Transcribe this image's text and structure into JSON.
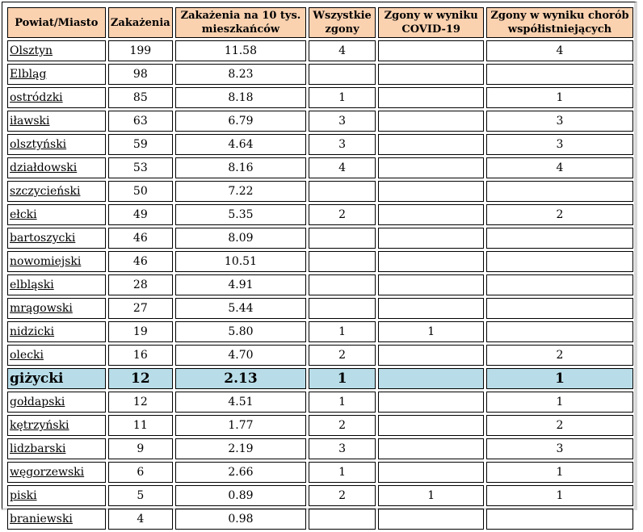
{
  "table": {
    "headers": [
      "Powiat/Miasto",
      "Zakażenia",
      "Zakażenia na 10 tys. mieszkańców",
      "Wszystkie zgony",
      "Zgony w wyniku COVID-19",
      "Zgony w wyniku chorób współistniejących"
    ],
    "rows": [
      [
        "Olsztyn",
        "199",
        "11.58",
        "4",
        "",
        "4"
      ],
      [
        "Elbląg",
        "98",
        "8.23",
        "",
        "",
        ""
      ],
      [
        "ostródzki",
        "85",
        "8.18",
        "1",
        "",
        "1"
      ],
      [
        "iławski",
        "63",
        "6.79",
        "3",
        "",
        "3"
      ],
      [
        "olsztyński",
        "59",
        "4.64",
        "3",
        "",
        "3"
      ],
      [
        "działdowski",
        "53",
        "8.16",
        "4",
        "",
        "4"
      ],
      [
        "szczycieński",
        "50",
        "7.22",
        "",
        "",
        ""
      ],
      [
        "ełcki",
        "49",
        "5.35",
        "2",
        "",
        "2"
      ],
      [
        "bartoszycki",
        "46",
        "8.09",
        "",
        "",
        ""
      ],
      [
        "nowomiejski",
        "46",
        "10.51",
        "",
        "",
        ""
      ],
      [
        "elbląski",
        "28",
        "4.91",
        "",
        "",
        ""
      ],
      [
        "mrągowski",
        "27",
        "5.44",
        "",
        "",
        ""
      ],
      [
        "nidzicki",
        "19",
        "5.80",
        "1",
        "1",
        ""
      ],
      [
        "olecki",
        "16",
        "4.70",
        "2",
        "",
        "2"
      ],
      [
        "giżycki",
        "12",
        "2.13",
        "1",
        "",
        "1"
      ],
      [
        "gołdapski",
        "12",
        "4.51",
        "1",
        "",
        "1"
      ],
      [
        "kętrzyński",
        "11",
        "1.77",
        "2",
        "",
        "2"
      ],
      [
        "lidzbarski",
        "9",
        "2.19",
        "3",
        "",
        "3"
      ],
      [
        "węgorzewski",
        "6",
        "2.66",
        "1",
        "",
        "1"
      ],
      [
        "piski",
        "5",
        "0.89",
        "2",
        "1",
        "1"
      ],
      [
        "braniewski",
        "4",
        "0.98",
        "",
        "",
        ""
      ]
    ],
    "highlighted_row": "giżycki",
    "colors": {
      "header_bg": "#fbd2b0",
      "highlight_bg": "#b8dde8"
    }
  }
}
